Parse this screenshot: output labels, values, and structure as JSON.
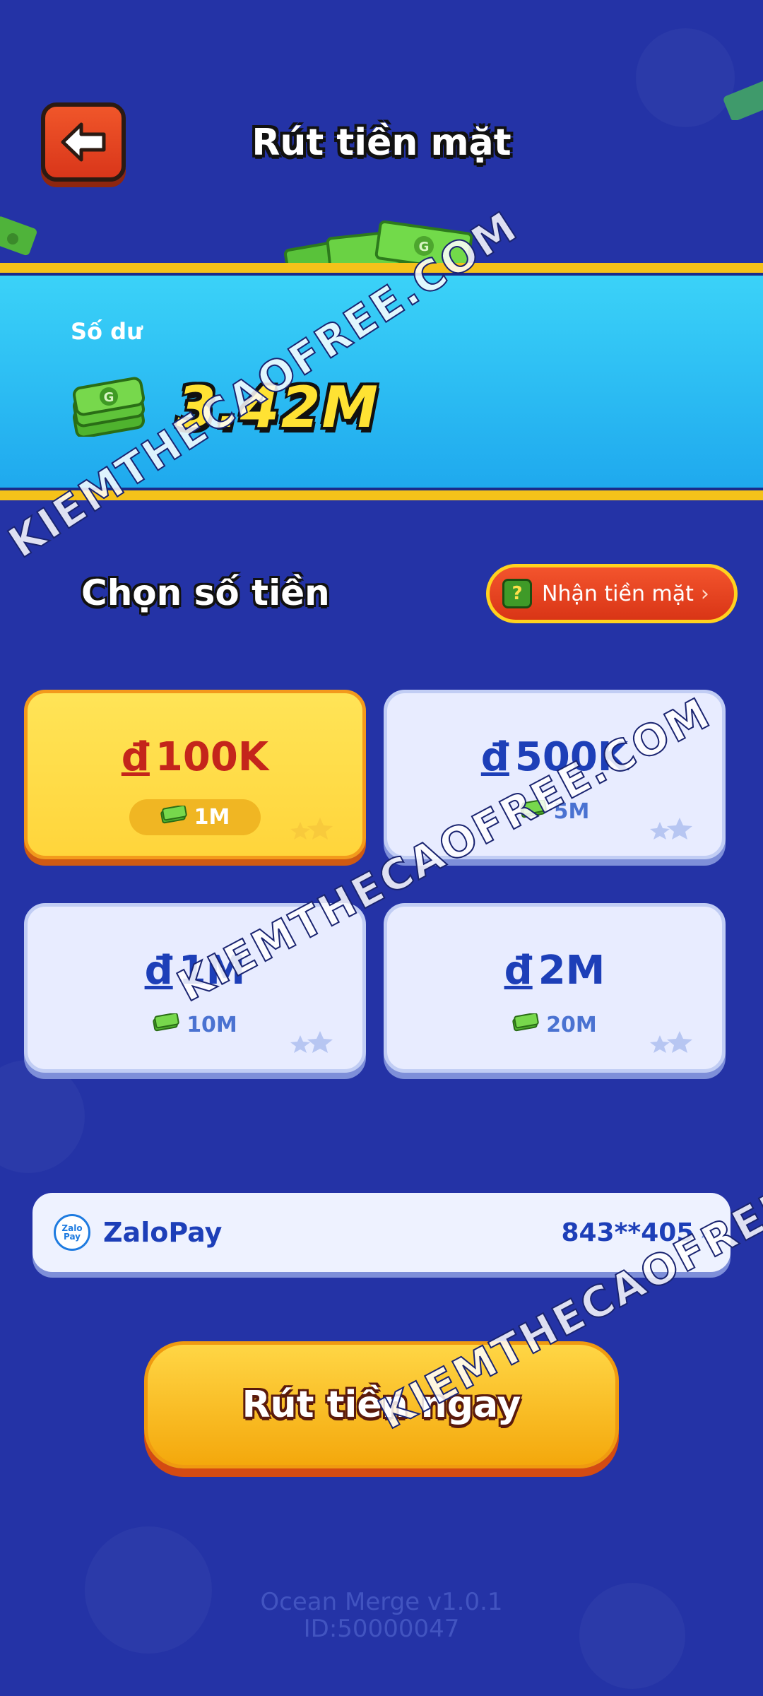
{
  "header": {
    "title": "Rút tiền mặt",
    "back_icon": "arrow-left-icon"
  },
  "balance": {
    "label": "Số dư",
    "value": "3.42M",
    "icon": "cash-stack-icon"
  },
  "select_amount": {
    "title": "Chọn số tiền",
    "get_cash_button": "Nhận tiền mặt"
  },
  "options": [
    {
      "currency": "đ",
      "amount": "100K",
      "cost": "1M",
      "selected": true
    },
    {
      "currency": "đ",
      "amount": "500K",
      "cost": "5M",
      "selected": false
    },
    {
      "currency": "đ",
      "amount": "1M",
      "cost": "10M",
      "selected": false
    },
    {
      "currency": "đ",
      "amount": "2M",
      "cost": "20M",
      "selected": false
    }
  ],
  "payment": {
    "logo_top": "Zalo",
    "logo_bottom": "Pay",
    "name": "ZaloPay",
    "account": "843**405"
  },
  "withdraw_button": "Rút tiền ngay",
  "footer": {
    "app_version": "Ocean Merge v1.0.1",
    "user_id": "ID:50000047"
  },
  "watermark": "KIEMTHECAOFREE.COM",
  "colors": {
    "background": "#2433a6",
    "accent_yellow": "#ffd53b",
    "accent_red": "#d93516",
    "banner_blue": "#1fa9ee"
  }
}
